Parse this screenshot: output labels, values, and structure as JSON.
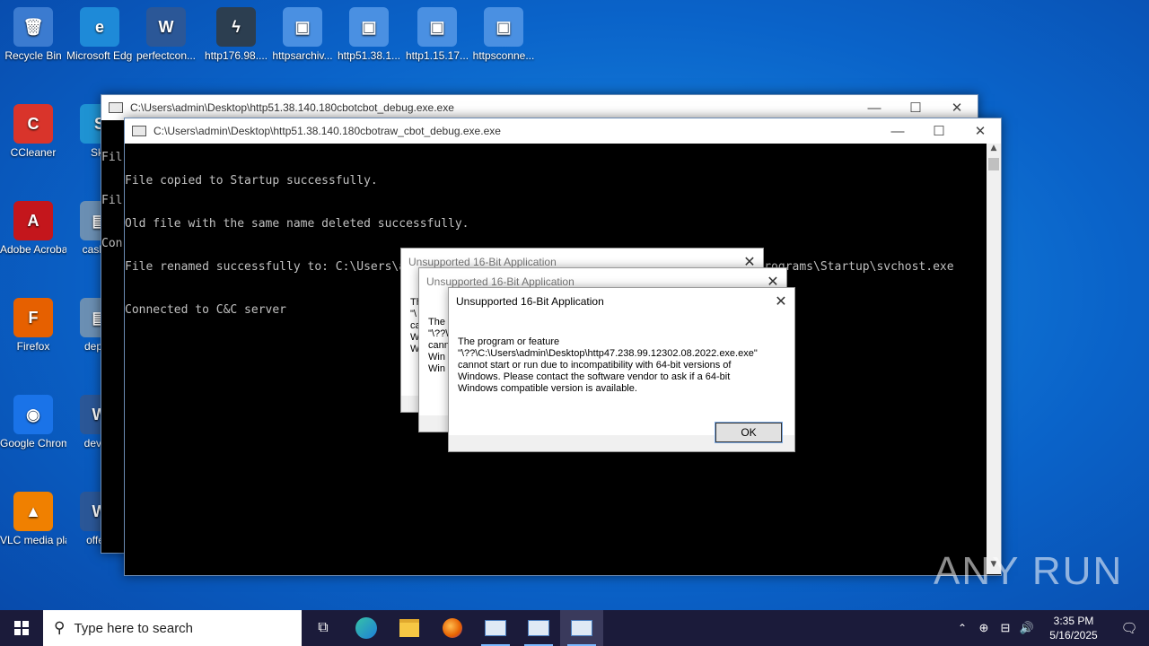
{
  "desktop": {
    "icons": [
      {
        "label": "Recycle Bin",
        "glyph": "🗑",
        "color": "#3b7bd0"
      },
      {
        "label": "Microsoft Edge",
        "glyph": "e",
        "color": "#1e8ad8"
      },
      {
        "label": "perfectcon...",
        "glyph": "W",
        "color": "#2b5797"
      },
      {
        "label": "http176.98....",
        "glyph": "ϟ",
        "color": "#2c3e50"
      },
      {
        "label": "httpsarchiv...",
        "glyph": "▣",
        "color": "#4a90e2"
      },
      {
        "label": "http51.38.1...",
        "glyph": "▣",
        "color": "#4a90e2"
      },
      {
        "label": "http1.15.17...",
        "glyph": "▣",
        "color": "#4a90e2"
      },
      {
        "label": "httpsconne...",
        "glyph": "▣",
        "color": "#4a90e2"
      },
      {
        "label": "CCleaner",
        "glyph": "C",
        "color": "#d9342b"
      },
      {
        "label": "Sky",
        "glyph": "S",
        "color": "#1f93d3"
      },
      {
        "label": "Adobe Acrobat",
        "glyph": "A",
        "color": "#c4161c"
      },
      {
        "label": "cashup",
        "glyph": "▤",
        "color": "#6b8fb3"
      },
      {
        "label": "Firefox",
        "glyph": "F",
        "color": "#e66000"
      },
      {
        "label": "depart",
        "glyph": "▤",
        "color": "#6b8fb3"
      },
      {
        "label": "Google Chrome",
        "glyph": "◉",
        "color": "#1a73e8"
      },
      {
        "label": "device",
        "glyph": "W",
        "color": "#2b5797"
      },
      {
        "label": "VLC media player",
        "glyph": "▲",
        "color": "#f08000"
      },
      {
        "label": "offers",
        "glyph": "W",
        "color": "#2b5797"
      }
    ]
  },
  "window_back": {
    "title": "C:\\Users\\admin\\Desktop\\http51.38.140.180cbotcbot_debug.exe.exe",
    "lines": [
      "Fil",
      "Fil",
      "Con"
    ]
  },
  "window_front": {
    "title": "C:\\Users\\admin\\Desktop\\http51.38.140.180cbotraw_cbot_debug.exe.exe",
    "lines": [
      "File copied to Startup successfully.",
      "Old file with the same name deleted successfully.",
      "File renamed successfully to: C:\\Users\\admin\\AppData\\Roaming\\Microsoft\\Windows\\Start Menu\\Programs\\Startup\\svchost.exe",
      "Connected to C&C server"
    ]
  },
  "dialog_back1": {
    "title": "Unsupported 16-Bit Application",
    "snippet": "Th\n\"\\\nca\nW\nW"
  },
  "dialog_back2": {
    "title": "Unsupported 16-Bit Application",
    "snippet": "The\n\"\\??\\\ncann\nWin\nWin"
  },
  "dialog_front": {
    "title": "Unsupported 16-Bit Application",
    "message": "The program or feature\n\"\\??\\C:\\Users\\admin\\Desktop\\http47.238.99.12302.08.2022.exe.exe\"\ncannot start or run due to incompatibility with 64-bit versions of\nWindows. Please contact the software vendor to ask if a 64-bit\nWindows compatible version is available.",
    "ok_label": "OK"
  },
  "watermark": "ANY RUN",
  "taskbar": {
    "search_placeholder": "Type here to search",
    "time": "3:35 PM",
    "date": "5/16/2025"
  }
}
